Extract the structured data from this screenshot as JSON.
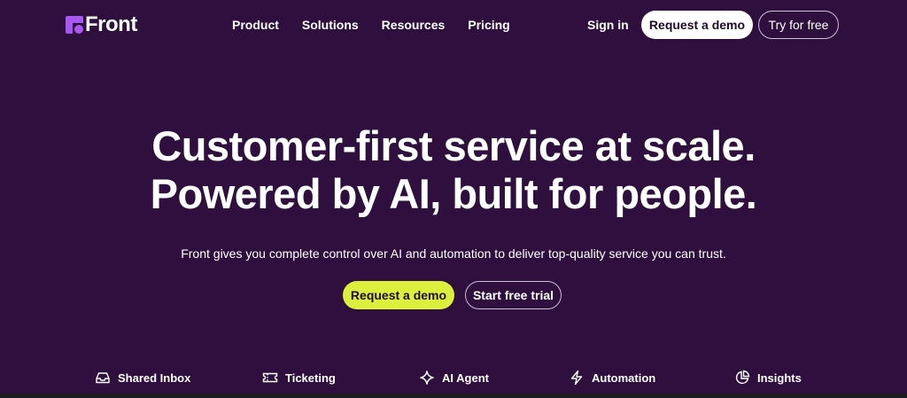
{
  "brand": {
    "name": "Front",
    "accent": "#a857f0"
  },
  "nav": {
    "items": [
      "Product",
      "Solutions",
      "Resources",
      "Pricing"
    ],
    "sign_in": "Sign in",
    "request_demo": "Request a demo",
    "try_free": "Try for free"
  },
  "hero": {
    "title_line1": "Customer-first service at scale.",
    "title_line2": "Powered by AI, built for people.",
    "subtitle": "Front gives you complete control over AI and automation to deliver top-quality service you can trust.",
    "primary_cta": "Request a demo",
    "secondary_cta": "Start free trial"
  },
  "features": [
    {
      "label": "Shared Inbox",
      "icon": "inbox-icon"
    },
    {
      "label": "Ticketing",
      "icon": "ticket-icon"
    },
    {
      "label": "AI Agent",
      "icon": "sparkle-icon"
    },
    {
      "label": "Automation",
      "icon": "lightning-icon"
    },
    {
      "label": "Insights",
      "icon": "pie-chart-icon"
    }
  ],
  "colors": {
    "background": "#2e0f3d",
    "cta_yellow": "#dcef3c",
    "text": "#ffffff"
  }
}
